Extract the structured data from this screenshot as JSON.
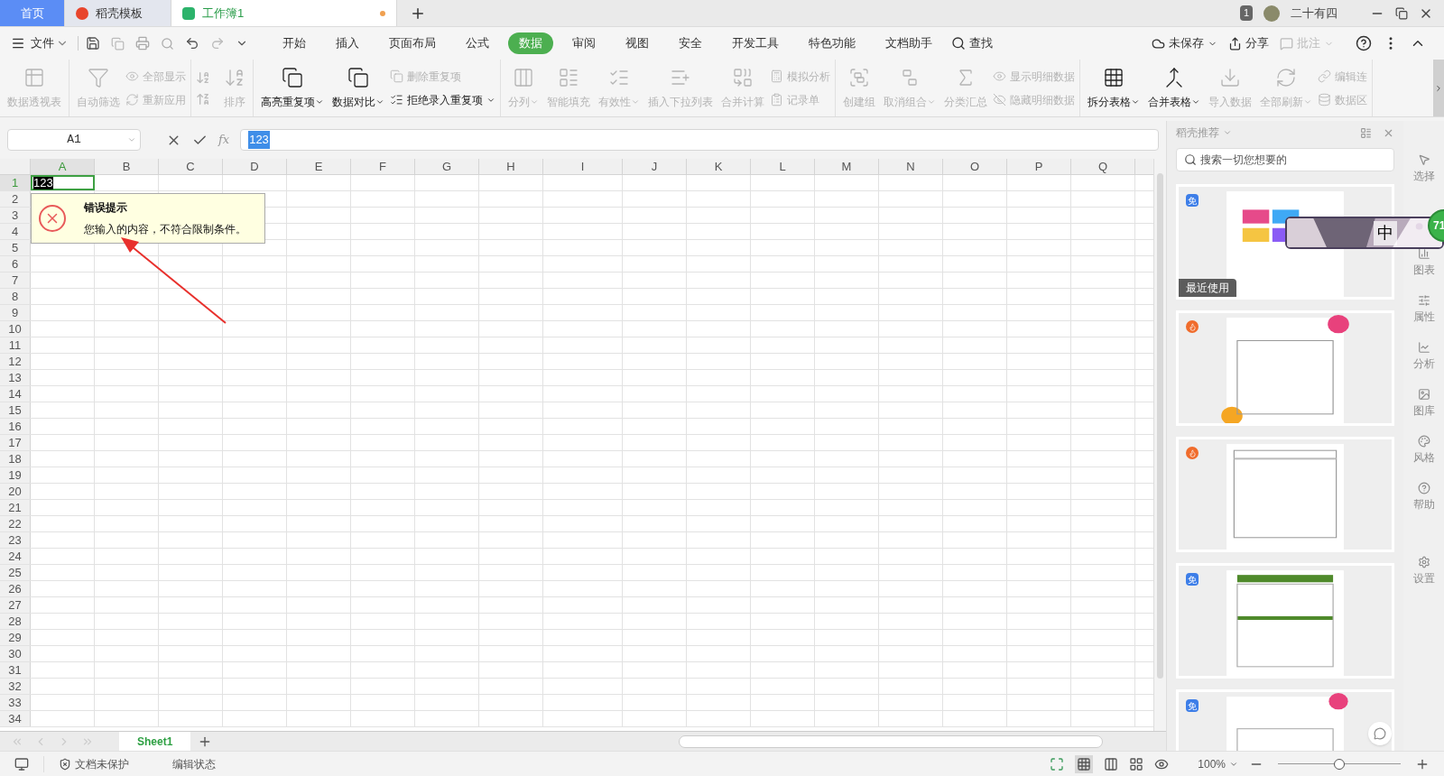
{
  "title_bar": {
    "tabs": [
      {
        "label": "首页",
        "kind": "home",
        "selected": false
      },
      {
        "label": "稻壳模板",
        "kind": "docer",
        "selected": false
      },
      {
        "label": "工作簿1",
        "kind": "sheet",
        "selected": true,
        "modified": true
      }
    ],
    "window_count": "1",
    "user": "二十有四"
  },
  "menu": {
    "file": "文件",
    "tabs": [
      {
        "label": "开始",
        "selected": false
      },
      {
        "label": "插入",
        "selected": false
      },
      {
        "label": "页面布局",
        "selected": false
      },
      {
        "label": "公式",
        "selected": false
      },
      {
        "label": "数据",
        "selected": true
      },
      {
        "label": "审阅",
        "selected": false
      },
      {
        "label": "视图",
        "selected": false
      },
      {
        "label": "安全",
        "selected": false
      },
      {
        "label": "开发工具",
        "selected": false
      },
      {
        "label": "特色功能",
        "selected": false
      },
      {
        "label": "文档助手",
        "selected": false
      }
    ],
    "search": "查找",
    "actions": [
      {
        "label": "未保存",
        "disabled": false,
        "dropdown": true
      },
      {
        "label": "分享",
        "disabled": false,
        "dropdown": false
      },
      {
        "label": "批注",
        "disabled": true,
        "dropdown": true
      }
    ]
  },
  "ribbon": {
    "groups": [
      {
        "items": [
          {
            "kind": "large",
            "label": "数据透视表",
            "disabled": true,
            "dropdown": false
          }
        ]
      },
      {
        "items": [
          {
            "kind": "large",
            "label": "自动筛选",
            "disabled": true,
            "dropdown": false
          },
          {
            "kind": "small",
            "label": "全部显示",
            "disabled": true,
            "dropdown": false
          },
          {
            "kind": "small",
            "label": "重新应用",
            "disabled": true,
            "dropdown": false
          }
        ]
      },
      {
        "items": [
          {
            "kind": "sort",
            "label": "排序",
            "disabled": true,
            "dropdown": false
          }
        ]
      },
      {
        "items": [
          {
            "kind": "large",
            "label": "高亮重复项",
            "disabled": false,
            "dropdown": true
          },
          {
            "kind": "large",
            "label": "数据对比",
            "disabled": false,
            "dropdown": true
          },
          {
            "kind": "small",
            "label": "删除重复项",
            "disabled": true,
            "dropdown": false
          },
          {
            "kind": "small",
            "label": "拒绝录入重复项",
            "disabled": false,
            "dropdown": true
          }
        ]
      },
      {
        "items": [
          {
            "kind": "large",
            "label": "分列",
            "disabled": true,
            "dropdown": true
          },
          {
            "kind": "large",
            "label": "智能填充",
            "disabled": true,
            "dropdown": false
          },
          {
            "kind": "large",
            "label": "有效性",
            "disabled": true,
            "dropdown": true
          },
          {
            "kind": "large",
            "label": "插入下拉列表",
            "disabled": true,
            "dropdown": false
          },
          {
            "kind": "large",
            "label": "合并计算",
            "disabled": true,
            "dropdown": false
          },
          {
            "kind": "small",
            "label": "模拟分析",
            "disabled": true,
            "dropdown": false
          },
          {
            "kind": "small",
            "label": "记录单",
            "disabled": true,
            "dropdown": false
          }
        ]
      },
      {
        "items": [
          {
            "kind": "large",
            "label": "创建组",
            "disabled": true,
            "dropdown": false
          },
          {
            "kind": "large",
            "label": "取消组合",
            "disabled": true,
            "dropdown": true
          },
          {
            "kind": "large",
            "label": "分类汇总",
            "disabled": true,
            "dropdown": false
          },
          {
            "kind": "small",
            "label": "显示明细数据",
            "disabled": true,
            "dropdown": false
          },
          {
            "kind": "small",
            "label": "隐藏明细数据",
            "disabled": true,
            "dropdown": false
          }
        ]
      },
      {
        "items": [
          {
            "kind": "large",
            "label": "拆分表格",
            "disabled": false,
            "dropdown": true
          },
          {
            "kind": "large",
            "label": "合并表格",
            "disabled": false,
            "dropdown": true
          },
          {
            "kind": "large",
            "label": "导入数据",
            "disabled": true,
            "dropdown": false
          },
          {
            "kind": "large",
            "label": "全部刷新",
            "disabled": true,
            "dropdown": true
          },
          {
            "kind": "small",
            "label": "编辑连",
            "disabled": true,
            "dropdown": false
          },
          {
            "kind": "small",
            "label": "数据区",
            "disabled": true,
            "dropdown": false
          }
        ]
      }
    ]
  },
  "formula_bar": {
    "name_box": "A1",
    "fx": "fx",
    "value": "123"
  },
  "grid": {
    "columns": [
      {
        "label": "A",
        "selected": true
      },
      {
        "label": "B",
        "selected": false
      },
      {
        "label": "C",
        "selected": false
      },
      {
        "label": "D",
        "selected": false
      },
      {
        "label": "E",
        "selected": false
      },
      {
        "label": "F",
        "selected": false
      },
      {
        "label": "G",
        "selected": false
      },
      {
        "label": "H",
        "selected": false
      },
      {
        "label": "I",
        "selected": false
      },
      {
        "label": "J",
        "selected": false
      },
      {
        "label": "K",
        "selected": false
      },
      {
        "label": "L",
        "selected": false
      },
      {
        "label": "M",
        "selected": false
      },
      {
        "label": "N",
        "selected": false
      },
      {
        "label": "O",
        "selected": false
      },
      {
        "label": "P",
        "selected": false
      },
      {
        "label": "Q",
        "selected": false
      }
    ],
    "rows": [
      {
        "label": "1",
        "selected": true
      },
      {
        "label": "2",
        "selected": false
      },
      {
        "label": "3",
        "selected": false
      },
      {
        "label": "4",
        "selected": false
      },
      {
        "label": "5",
        "selected": false
      },
      {
        "label": "6",
        "selected": false
      },
      {
        "label": "7",
        "selected": false
      },
      {
        "label": "8",
        "selected": false
      },
      {
        "label": "9",
        "selected": false
      },
      {
        "label": "10",
        "selected": false
      },
      {
        "label": "11",
        "selected": false
      },
      {
        "label": "12",
        "selected": false
      },
      {
        "label": "13",
        "selected": false
      },
      {
        "label": "14",
        "selected": false
      },
      {
        "label": "15",
        "selected": false
      },
      {
        "label": "16",
        "selected": false
      },
      {
        "label": "17",
        "selected": false
      },
      {
        "label": "18",
        "selected": false
      },
      {
        "label": "19",
        "selected": false
      },
      {
        "label": "20",
        "selected": false
      },
      {
        "label": "21",
        "selected": false
      },
      {
        "label": "22",
        "selected": false
      },
      {
        "label": "23",
        "selected": false
      },
      {
        "label": "24",
        "selected": false
      },
      {
        "label": "25",
        "selected": false
      },
      {
        "label": "26",
        "selected": false
      },
      {
        "label": "27",
        "selected": false
      },
      {
        "label": "28",
        "selected": false
      },
      {
        "label": "29",
        "selected": false
      },
      {
        "label": "30",
        "selected": false
      },
      {
        "label": "31",
        "selected": false
      },
      {
        "label": "32",
        "selected": false
      },
      {
        "label": "33",
        "selected": false
      },
      {
        "label": "34",
        "selected": false
      }
    ],
    "active_cell": {
      "value": "123"
    }
  },
  "error_tip": {
    "title": "错误提示",
    "message": "您输入的内容，不符合限制条件。"
  },
  "sheet_tabs": [
    {
      "label": "Sheet1",
      "selected": true
    }
  ],
  "status_bar": {
    "protection": "文档未保护",
    "mode": "编辑状态",
    "zoom": "100%",
    "zoom_slider": {
      "level": 0.5
    }
  },
  "panel": {
    "title": "稻壳推荐",
    "search": {
      "placeholder": "搜索一切您想要的"
    },
    "cards": [
      {
        "kind": "free",
        "badge": "免",
        "recent": "最近使用"
      },
      {
        "kind": "hot"
      },
      {
        "kind": "hot"
      },
      {
        "kind": "free",
        "badge": "免"
      },
      {
        "kind": "free",
        "badge": "免"
      }
    ]
  },
  "side_tools": [
    {
      "label": "选择"
    },
    {
      "label": "图表"
    },
    {
      "label": "属性"
    },
    {
      "label": "分析"
    },
    {
      "label": "图库"
    },
    {
      "label": "风格"
    },
    {
      "label": "帮助"
    },
    {
      "label": "设置"
    }
  ],
  "floating_widget": {
    "ime": "中",
    "count": "71"
  }
}
